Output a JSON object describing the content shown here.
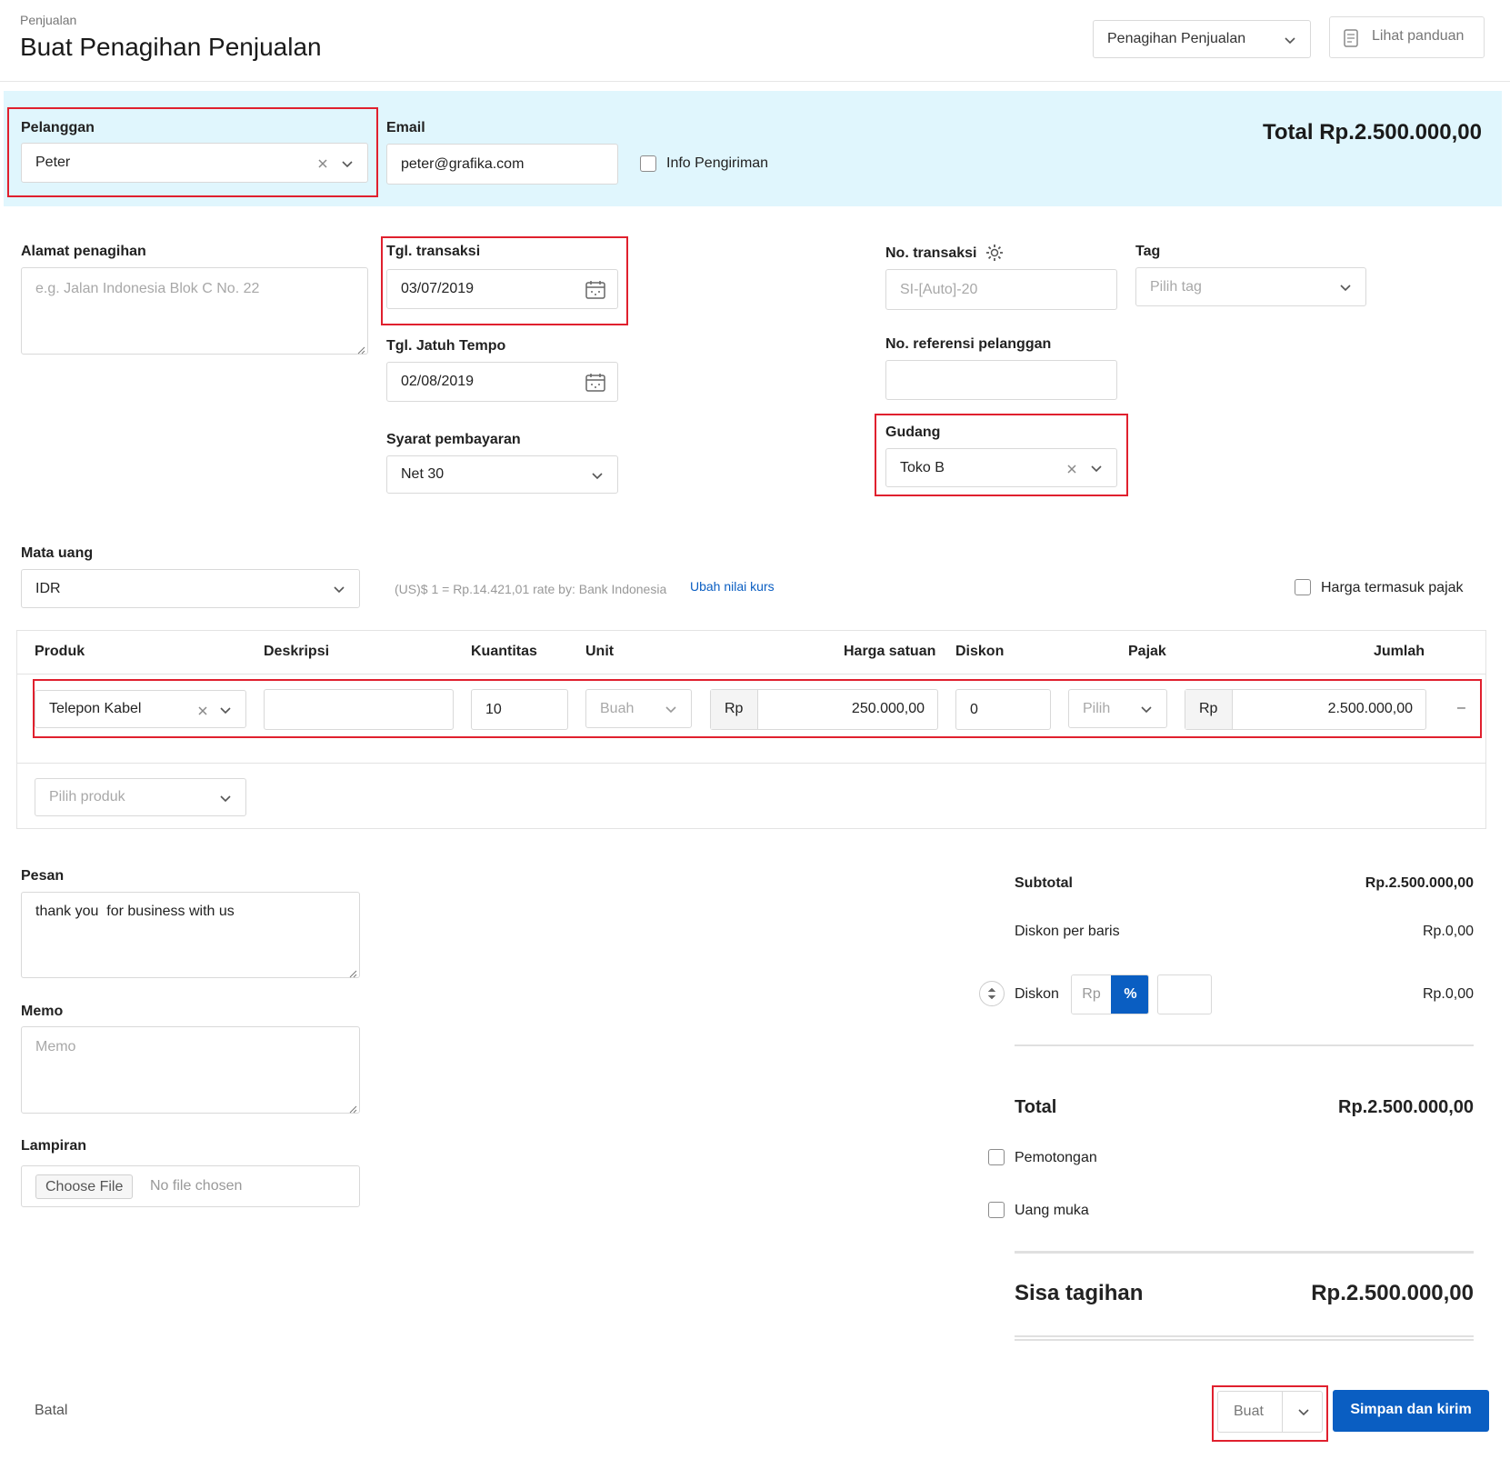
{
  "header": {
    "breadcrumb": "Penjualan",
    "title": "Buat Penagihan Penjualan",
    "type_select": "Penagihan Penjualan",
    "guide_button": "Lihat panduan"
  },
  "top": {
    "customer_label": "Pelanggan",
    "customer_value": "Peter",
    "email_label": "Email",
    "email_value": "peter@grafika.com",
    "shipping_info": "Info Pengiriman",
    "total": "Total Rp.2.500.000,00"
  },
  "form": {
    "billing_address_label": "Alamat penagihan",
    "billing_address_placeholder": "e.g. Jalan Indonesia Blok C No. 22",
    "trans_date_label": "Tgl. transaksi",
    "trans_date_value": "03/07/2019",
    "due_date_label": "Tgl. Jatuh Tempo",
    "due_date_value": "02/08/2019",
    "payment_terms_label": "Syarat pembayaran",
    "payment_terms_value": "Net 30",
    "trans_no_label": "No. transaksi",
    "trans_no_placeholder": "SI-[Auto]-20",
    "tag_label": "Tag",
    "tag_placeholder": "Pilih tag",
    "customer_ref_label": "No. referensi pelanggan",
    "warehouse_label": "Gudang",
    "warehouse_value": "Toko B",
    "currency_label": "Mata uang",
    "currency_value": "IDR",
    "rate_text": "(US)$ 1 = Rp.14.421,01 rate by: Bank Indonesia",
    "change_rate_link": "Ubah nilai kurs",
    "tax_inclusive": "Harga termasuk pajak"
  },
  "table": {
    "headers": [
      "Produk",
      "Deskripsi",
      "Kuantitas",
      "Unit",
      "Harga satuan",
      "Diskon",
      "Pajak",
      "Jumlah"
    ],
    "row": {
      "product": "Telepon Kabel",
      "description": "",
      "quantity": "10",
      "unit": "Buah",
      "currency_prefix": "Rp",
      "unit_price": "250.000,00",
      "discount": "0",
      "tax_placeholder": "Pilih",
      "amount": "2.500.000,00",
      "remove": "–"
    },
    "add_product_placeholder": "Pilih produk"
  },
  "bottom": {
    "message_label": "Pesan",
    "message_value": "thank you  for business with us",
    "memo_label": "Memo",
    "memo_placeholder": "Memo",
    "attachment_label": "Lampiran",
    "choose_file": "Choose File",
    "no_file": "No file chosen"
  },
  "summary": {
    "subtotal_label": "Subtotal",
    "subtotal_value": "Rp.2.500.000,00",
    "line_discount_label": "Diskon per baris",
    "line_discount_value": "Rp.0,00",
    "discount_label": "Diskon",
    "discount_rp": "Rp",
    "discount_pct": "%",
    "discount_value": "Rp.0,00",
    "total_label": "Total",
    "total_value": "Rp.2.500.000,00",
    "deduction_label": "Pemotongan",
    "down_payment_label": "Uang muka",
    "balance_label": "Sisa tagihan",
    "balance_value": "Rp.2.500.000,00"
  },
  "footer": {
    "cancel": "Batal",
    "create": "Buat",
    "save_send": "Simpan dan kirim"
  },
  "colors": {
    "accent": "#0a5ec2",
    "header_band": "#e0f6fd",
    "highlight": "#e0202e"
  }
}
